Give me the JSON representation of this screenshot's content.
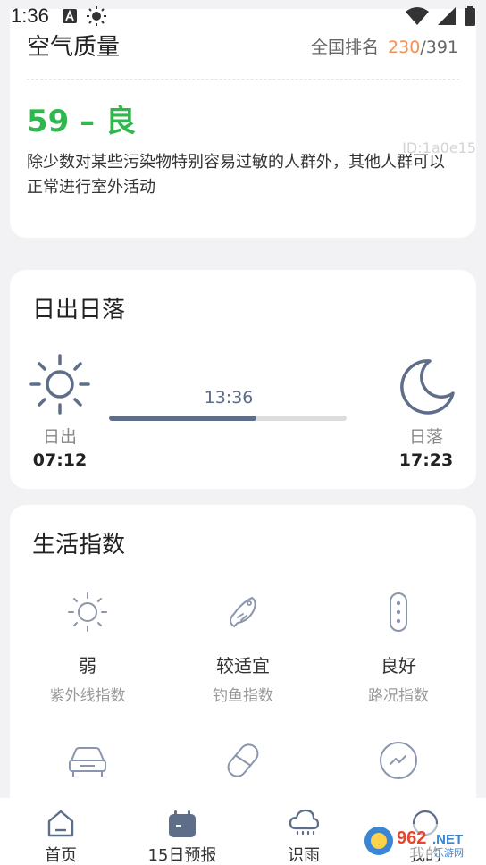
{
  "status": {
    "time": "1:36"
  },
  "air_quality": {
    "title": "空气质量",
    "rank_label": "全国排名",
    "rank": "230",
    "rank_total": "/391",
    "value": "59 – 良",
    "description": "除少数对某些污染物特别容易过敏的人群外，其他人群可以正常进行室外活动",
    "id_text": "ID:1a0e15"
  },
  "sun": {
    "title": "日出日落",
    "sunrise_label": "日出",
    "sunrise_time": "07:12",
    "sunset_label": "日落",
    "sunset_time": "17:23",
    "now": "13:36",
    "progress_fraction": 0.62
  },
  "life": {
    "title": "生活指数",
    "items": [
      {
        "value": "弱",
        "label": "紫外线指数",
        "icon": "sun-icon"
      },
      {
        "value": "较适宜",
        "label": "钓鱼指数",
        "icon": "fish-icon"
      },
      {
        "value": "良好",
        "label": "路况指数",
        "icon": "traffic-light-icon"
      },
      {
        "value": "",
        "label": "",
        "icon": "car-icon"
      },
      {
        "value": "",
        "label": "",
        "icon": "pill-icon"
      },
      {
        "value": "",
        "label": "",
        "icon": "check-circle-icon"
      }
    ]
  },
  "nav": {
    "items": [
      {
        "label": "首页",
        "icon": "home-icon"
      },
      {
        "label": "15日预报",
        "icon": "calendar-icon"
      },
      {
        "label": "识雨",
        "icon": "rain-cloud-icon"
      },
      {
        "label": "我的",
        "icon": "profile-icon"
      }
    ]
  },
  "colors": {
    "aqi_good": "#2fb84e",
    "rank_accent": "#f0915a",
    "icon_stroke": "#5f6e88"
  }
}
